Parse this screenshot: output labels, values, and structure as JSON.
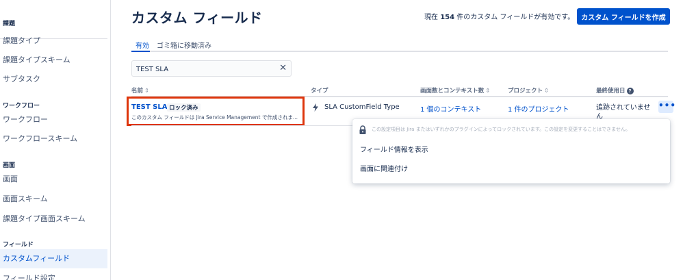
{
  "sidebar": {
    "sections": [
      {
        "title": "課題",
        "items": [
          "課題タイプ",
          "課題タイプスキーム",
          "サブタスク"
        ]
      },
      {
        "title": "ワークフロー",
        "items": [
          "ワークフロー",
          "ワークフロースキーム"
        ]
      },
      {
        "title": "画面",
        "items": [
          "画面",
          "画面スキーム",
          "課題タイプ画面スキーム"
        ]
      },
      {
        "title": "フィールド",
        "items": [
          "カスタムフィールド",
          "フィールド設定"
        ]
      }
    ]
  },
  "header": {
    "title": "カスタム フィールド",
    "count_prefix": "現在",
    "count": "154",
    "count_suffix": "件のカスタム フィールドが有効です。",
    "create_button": "カスタム フィールドを作成"
  },
  "tabs": [
    {
      "label": "有効",
      "active": true
    },
    {
      "label": "ゴミ箱に移動済み",
      "active": false
    }
  ],
  "search": {
    "value": "TEST SLA",
    "clear_icon": "close-icon"
  },
  "table": {
    "headers": {
      "name": "名前",
      "type": "タイプ",
      "screens_contexts": "画面数とコンテキスト数",
      "projects": "プロジェクト",
      "last_used": "最終使用日"
    },
    "sort_glyph": "⇕",
    "rows": [
      {
        "name": "TEST SLA",
        "badge": "ロック済み",
        "description": "このカスタム フィールドは Jira Service Management で作成されま...",
        "type": "SLA CustomField Type",
        "contexts": "1 個のコンテキスト",
        "projects": "1 件のプロジェクト",
        "last_used": "追跡されていません"
      }
    ]
  },
  "menu": {
    "lock_message": "この設定項目は Jira またはいずれかのプラグインによってロックされています。この設定を変更することはできません。",
    "items": [
      "フィールド情報を表示",
      "画面に関連付け"
    ]
  },
  "colors": {
    "accent": "#0052cc",
    "highlight": "#de350b"
  }
}
